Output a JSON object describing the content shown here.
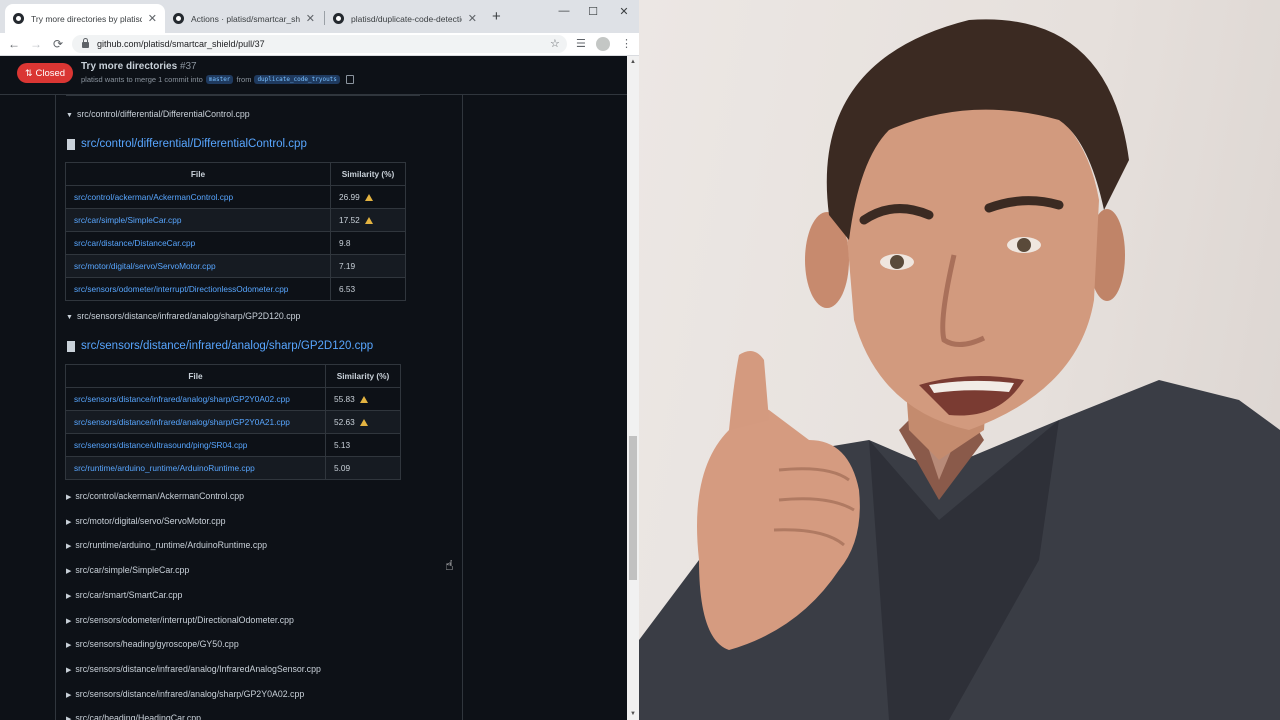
{
  "browser": {
    "tabs": [
      {
        "title": "Try more directories by platisd · P",
        "active": true
      },
      {
        "title": "Actions · platisd/smartcar_shield",
        "active": false
      },
      {
        "title": "platisd/duplicate-code-detection",
        "active": false
      }
    ],
    "new_tab": "+",
    "address": "github.com/platisd/smartcar_shield/pull/37",
    "window_controls": {
      "minimize": "—",
      "maximize": "☐",
      "close": "✕"
    },
    "nav": {
      "back": "←",
      "forward": "→",
      "reload": "⟳"
    }
  },
  "pr": {
    "status": "Closed",
    "title": "Try more directories",
    "number": "#37",
    "subtitle_user": "platisd",
    "subtitle_text": "wants to merge 1 commit into",
    "base_branch": "master",
    "from_text": "from",
    "head_branch": "duplicate_code_tryouts"
  },
  "sections": {
    "differential": {
      "summary": "src/control/differential/DifferentialControl.cpp",
      "heading": "src/control/differential/DifferentialControl.cpp",
      "header_file": "File",
      "header_similarity": "Similarity (%)",
      "rows": [
        {
          "file": "src/control/ackerman/AckermanControl.cpp",
          "similarity": "26.99",
          "warn": true
        },
        {
          "file": "src/car/simple/SimpleCar.cpp",
          "similarity": "17.52",
          "warn": true
        },
        {
          "file": "src/car/distance/DistanceCar.cpp",
          "similarity": "9.8",
          "warn": false
        },
        {
          "file": "src/motor/digital/servo/ServoMotor.cpp",
          "similarity": "7.19",
          "warn": false
        },
        {
          "file": "src/sensors/odometer/interrupt/DirectionlessOdometer.cpp",
          "similarity": "6.53",
          "warn": false
        }
      ]
    },
    "gp2d120": {
      "summary": "src/sensors/distance/infrared/analog/sharp/GP2D120.cpp",
      "heading": "src/sensors/distance/infrared/analog/sharp/GP2D120.cpp",
      "header_file": "File",
      "header_similarity": "Similarity (%)",
      "rows": [
        {
          "file": "src/sensors/distance/infrared/analog/sharp/GP2Y0A02.cpp",
          "similarity": "55.83",
          "warn": true
        },
        {
          "file": "src/sensors/distance/infrared/analog/sharp/GP2Y0A21.cpp",
          "similarity": "52.63",
          "warn": true
        },
        {
          "file": "src/sensors/distance/ultrasound/ping/SR04.cpp",
          "similarity": "5.13",
          "warn": false
        },
        {
          "file": "src/runtime/arduino_runtime/ArduinoRuntime.cpp",
          "similarity": "5.09",
          "warn": false
        }
      ]
    },
    "collapsed": [
      "src/control/ackerman/AckermanControl.cpp",
      "src/motor/digital/servo/ServoMotor.cpp",
      "src/runtime/arduino_runtime/ArduinoRuntime.cpp",
      "src/car/simple/SimpleCar.cpp",
      "src/car/smart/SmartCar.cpp",
      "src/sensors/odometer/interrupt/DirectionalOdometer.cpp",
      "src/sensors/heading/gyroscope/GY50.cpp",
      "src/sensors/distance/infrared/analog/InfraredAnalogSensor.cpp",
      "src/sensors/distance/infrared/analog/sharp/GP2Y0A02.cpp",
      "src/car/heading/HeadingCar.cpp"
    ]
  },
  "colors": {
    "page_bg": "#0d1117",
    "link": "#58a6ff",
    "closed_badge": "#da3633",
    "warning": "#e3b341"
  }
}
